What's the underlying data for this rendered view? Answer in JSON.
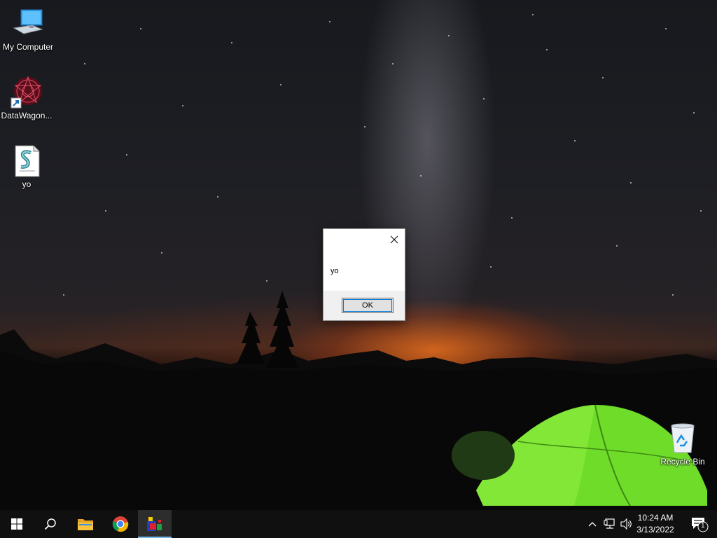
{
  "desktop": {
    "icons": [
      {
        "label": "My Computer",
        "icon": "computer-icon"
      },
      {
        "label": "DataWagon...",
        "icon": "datawagon-icon"
      },
      {
        "label": "yo",
        "icon": "script-file-icon"
      },
      {
        "label": "Recycle Bin",
        "icon": "recycle-bin-icon"
      }
    ]
  },
  "dialog": {
    "message": "yo",
    "ok_label": "OK",
    "close_icon": "close-icon"
  },
  "taskbar": {
    "start_icon": "windows-start-icon",
    "search_icon": "search-icon",
    "pinned": [
      {
        "name": "File Explorer",
        "icon": "folder-icon"
      },
      {
        "name": "Google Chrome",
        "icon": "chrome-icon"
      },
      {
        "name": "Running App",
        "icon": "app-icon",
        "active": true
      }
    ],
    "tray": {
      "chevron_icon": "chevron-up-icon",
      "network_icon": "network-icon",
      "volume_icon": "volume-icon",
      "time": "10:24 AM",
      "date": "3/13/2022",
      "notification_count": "1"
    }
  },
  "colors": {
    "taskbar": "#101010",
    "accent": "#0078d7",
    "tent_green": "#6fdc2a"
  }
}
